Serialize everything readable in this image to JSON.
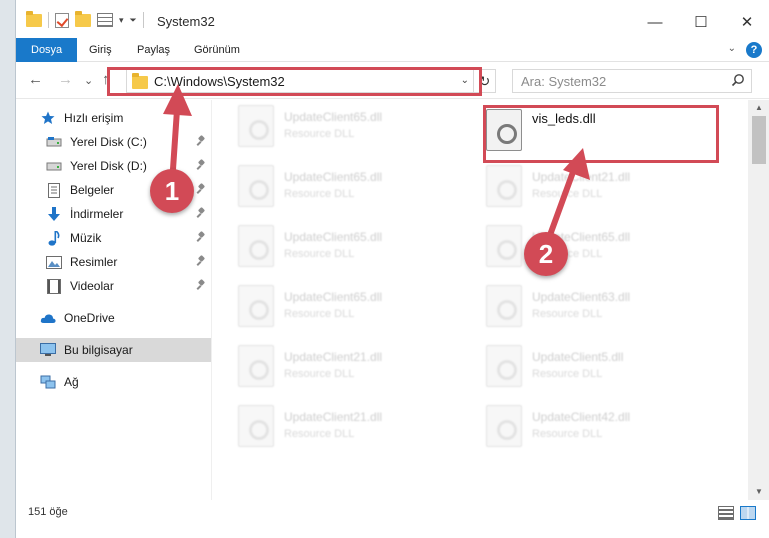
{
  "window": {
    "title": "System32",
    "minimize_glyph": "—",
    "maximize_glyph": "☐",
    "close_glyph": "✕"
  },
  "ribbon": {
    "tabs": [
      "Dosya",
      "Giriş",
      "Paylaş",
      "Görünüm"
    ],
    "help_glyph": "?",
    "collapse_glyph": "⌄"
  },
  "nav": {
    "back_glyph": "←",
    "forward_glyph": "→",
    "recent_glyph": "⌄",
    "up_glyph": "↑",
    "address_path": "C:\\Windows\\System32",
    "address_dropdown_glyph": "⌄",
    "refresh_glyph": "↻",
    "search_placeholder": "Ara: System32"
  },
  "sidebar": {
    "items": [
      {
        "label": "Hızlı erişim",
        "icon": "star-icon",
        "pinned": false
      },
      {
        "label": "Yerel Disk (C:)",
        "icon": "drive-icon",
        "pinned": true
      },
      {
        "label": "Yerel Disk (D:)",
        "icon": "drive-icon",
        "pinned": true
      },
      {
        "label": "Belgeler",
        "icon": "documents-icon",
        "pinned": true
      },
      {
        "label": "İndirmeler",
        "icon": "download-icon",
        "pinned": true
      },
      {
        "label": "Müzik",
        "icon": "music-icon",
        "pinned": true
      },
      {
        "label": "Resimler",
        "icon": "pictures-icon",
        "pinned": true
      },
      {
        "label": "Videolar",
        "icon": "videos-icon",
        "pinned": true
      },
      {
        "label": "OneDrive",
        "icon": "cloud-icon",
        "pinned": false
      },
      {
        "label": "Bu bilgisayar",
        "icon": "computer-icon",
        "pinned": false,
        "selected": true
      },
      {
        "label": "Ağ",
        "icon": "network-icon",
        "pinned": false
      }
    ]
  },
  "files": {
    "left_column": [
      {
        "name": "UpdateClient65.dll",
        "type": "Resource DLL"
      },
      {
        "name": "UpdateClient65.dll",
        "type": "Resource DLL"
      },
      {
        "name": "UpdateClient65.dll",
        "type": "Resource DLL"
      },
      {
        "name": "UpdateClient65.dll",
        "type": "Resource DLL"
      },
      {
        "name": "UpdateClient21.dll",
        "type": "Resource DLL"
      },
      {
        "name": "UpdateClient21.dll",
        "type": "Resource DLL"
      }
    ],
    "right_column": [
      {
        "name": "vis_leds.dll",
        "type": ""
      },
      {
        "name": "UpdateClient21.dll",
        "type": "Resource DLL"
      },
      {
        "name": "UpdateClient65.dll",
        "type": "Resource DLL"
      },
      {
        "name": "UpdateClient63.dll",
        "type": "Resource DLL"
      },
      {
        "name": "UpdateClient5.dll",
        "type": "Resource DLL"
      },
      {
        "name": "UpdateClient42.dll",
        "type": "Resource DLL"
      }
    ]
  },
  "scrollbar": {
    "up_glyph": "▲",
    "down_glyph": "▼"
  },
  "status": {
    "item_count": "151 öğe"
  },
  "annotations": {
    "step1": "1",
    "step2": "2",
    "color": "#d24a56"
  }
}
